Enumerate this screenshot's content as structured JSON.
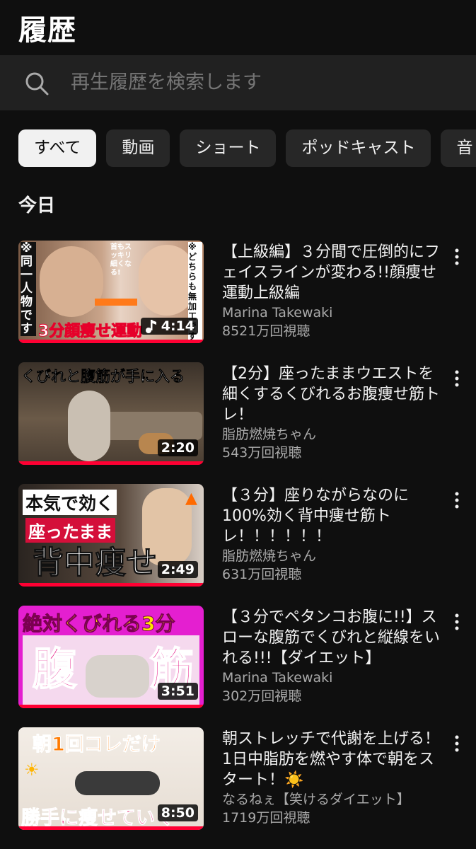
{
  "header": {
    "title": "履歴"
  },
  "search": {
    "placeholder": "再生履歴を検索します"
  },
  "chips": [
    {
      "label": "すべて",
      "active": true
    },
    {
      "label": "動画"
    },
    {
      "label": "ショート"
    },
    {
      "label": "ポッドキャスト"
    },
    {
      "label": "音"
    }
  ],
  "section": {
    "title": "今日"
  },
  "videos": [
    {
      "title": "【上級編】３分間で圧倒的にフェイスラインが変わる!!顔痩せ運動上級編",
      "channel": "Marina Takewaki",
      "views": "8521万回視聴",
      "duration": "4:14",
      "watched_fraction": 1.0,
      "thumb_text": [
        "※同一人物です",
        "首もスッキリ細くなる!",
        "※どちらも無加工です",
        "3分顔痩せ運動"
      ]
    },
    {
      "title": "【2分】座ったままウエストを細くするくびれるお腹痩せ筋トレ！",
      "channel": "脂肪燃焼ちゃん",
      "views": "543万回視聴",
      "duration": "2:20",
      "watched_fraction": 1.0,
      "thumb_text": [
        "くびれと腹筋が手に入る"
      ]
    },
    {
      "title": "【３分】座りながらなのに100%効く背中痩せ筋トレ！！！！！！",
      "channel": "脂肪燃焼ちゃん",
      "views": "631万回視聴",
      "duration": "2:49",
      "watched_fraction": 1.0,
      "thumb_text": [
        "本気で効く",
        "座ったまま",
        "背中痩せ"
      ]
    },
    {
      "title": "【３分でペタンコお腹に!!】スローな腹筋でくびれと縦線をいれる!!!【ダイエット】",
      "channel": "Marina Takewaki",
      "views": "302万回視聴",
      "duration": "3:51",
      "watched_fraction": 1.0,
      "thumb_text": [
        "絶対くびれる3分",
        "腹",
        "筋"
      ]
    },
    {
      "title": "朝ストレッチで代謝を上げる！1日中脂肪を燃やす体で朝をスタート！☀️",
      "channel": "なるねぇ【笑けるダイエット】",
      "views": "1719万回視聴",
      "duration": "8:50",
      "watched_fraction": 1.0,
      "thumb_text": [
        "朝1回コレだけ",
        "勝手に痩せていく"
      ]
    }
  ],
  "colors": {
    "background": "#0f0f0f",
    "progress": "#ff0033",
    "chip_active": "#f1f1f1"
  }
}
